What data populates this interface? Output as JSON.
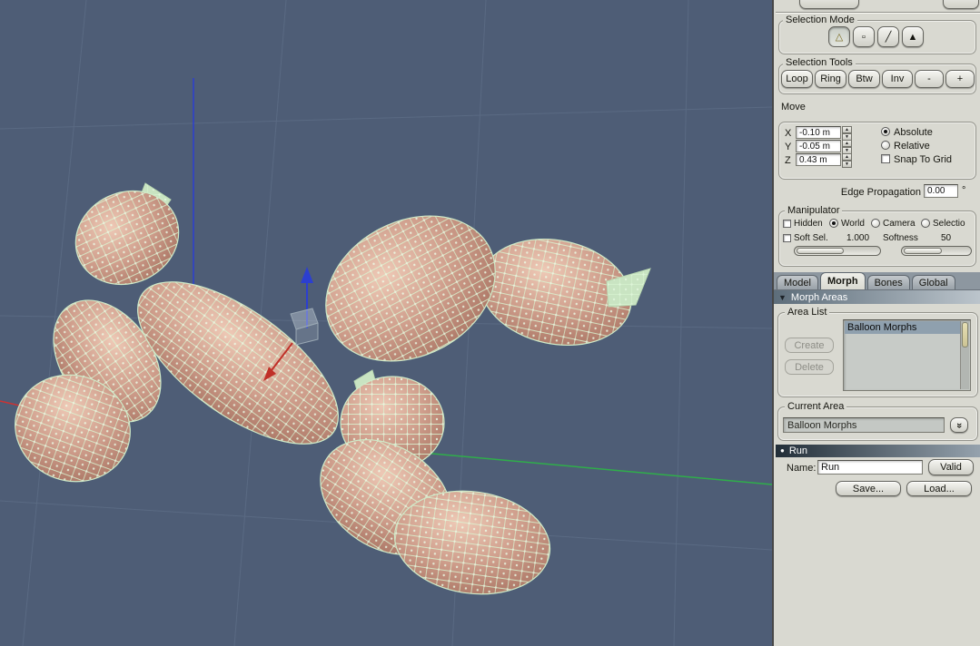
{
  "selection_mode": {
    "title": "Selection Mode",
    "buttons": [
      {
        "icon": "△"
      },
      {
        "icon": "▫"
      },
      {
        "icon": "╱"
      },
      {
        "icon": "▲"
      }
    ]
  },
  "selection_tools": {
    "title": "Selection Tools",
    "buttons": [
      "Loop",
      "Ring",
      "Btw",
      "Inv",
      "-",
      "+"
    ]
  },
  "move": {
    "title": "Move",
    "axes": [
      {
        "label": "X",
        "value": "-0.10 m"
      },
      {
        "label": "Y",
        "value": "-0.05 m"
      },
      {
        "label": "Z",
        "value": "0.43 m"
      }
    ],
    "mode_radios": [
      {
        "label": "Absolute",
        "selected": true
      },
      {
        "label": "Relative",
        "selected": false
      }
    ],
    "snap_checkbox": "Snap To Grid",
    "edge_propagation": {
      "label": "Edge Propagation",
      "value": "0.00",
      "unit": "°"
    }
  },
  "manipulator": {
    "title": "Manipulator",
    "hidden_checkbox": "Hidden",
    "space_radios": [
      {
        "label": "World",
        "selected": true
      },
      {
        "label": "Camera",
        "selected": false
      },
      {
        "label": "Selectio",
        "selected": false
      }
    ],
    "soft_sel": {
      "label": "Soft Sel.",
      "value": "1.000"
    },
    "softness": {
      "label": "Softness",
      "value": "50"
    }
  },
  "tabs": [
    {
      "label": "Model"
    },
    {
      "label": "Morph"
    },
    {
      "label": "Bones"
    },
    {
      "label": "Global"
    }
  ],
  "morph_areas": {
    "header": "Morph Areas",
    "area_list": {
      "title": "Area List",
      "create_button": "Create",
      "delete_button": "Delete",
      "items": [
        "Balloon Morphs"
      ]
    },
    "current_area": {
      "title": "Current Area",
      "value": "Balloon Morphs"
    },
    "run_item": "Run",
    "name_label": "Name:",
    "name_value": "Run",
    "valid_button": "Valid",
    "save_button": "Save...",
    "load_button": "Load..."
  },
  "viewport_colors": {
    "background": "#4e5d76",
    "grid": "#5a6a83",
    "x_axis": "#cc3333",
    "y_axis": "#2c3fd0",
    "z_axis": "#2fae4a",
    "balloon": "#cf9e8c",
    "mesh": "#d9f6d2"
  }
}
